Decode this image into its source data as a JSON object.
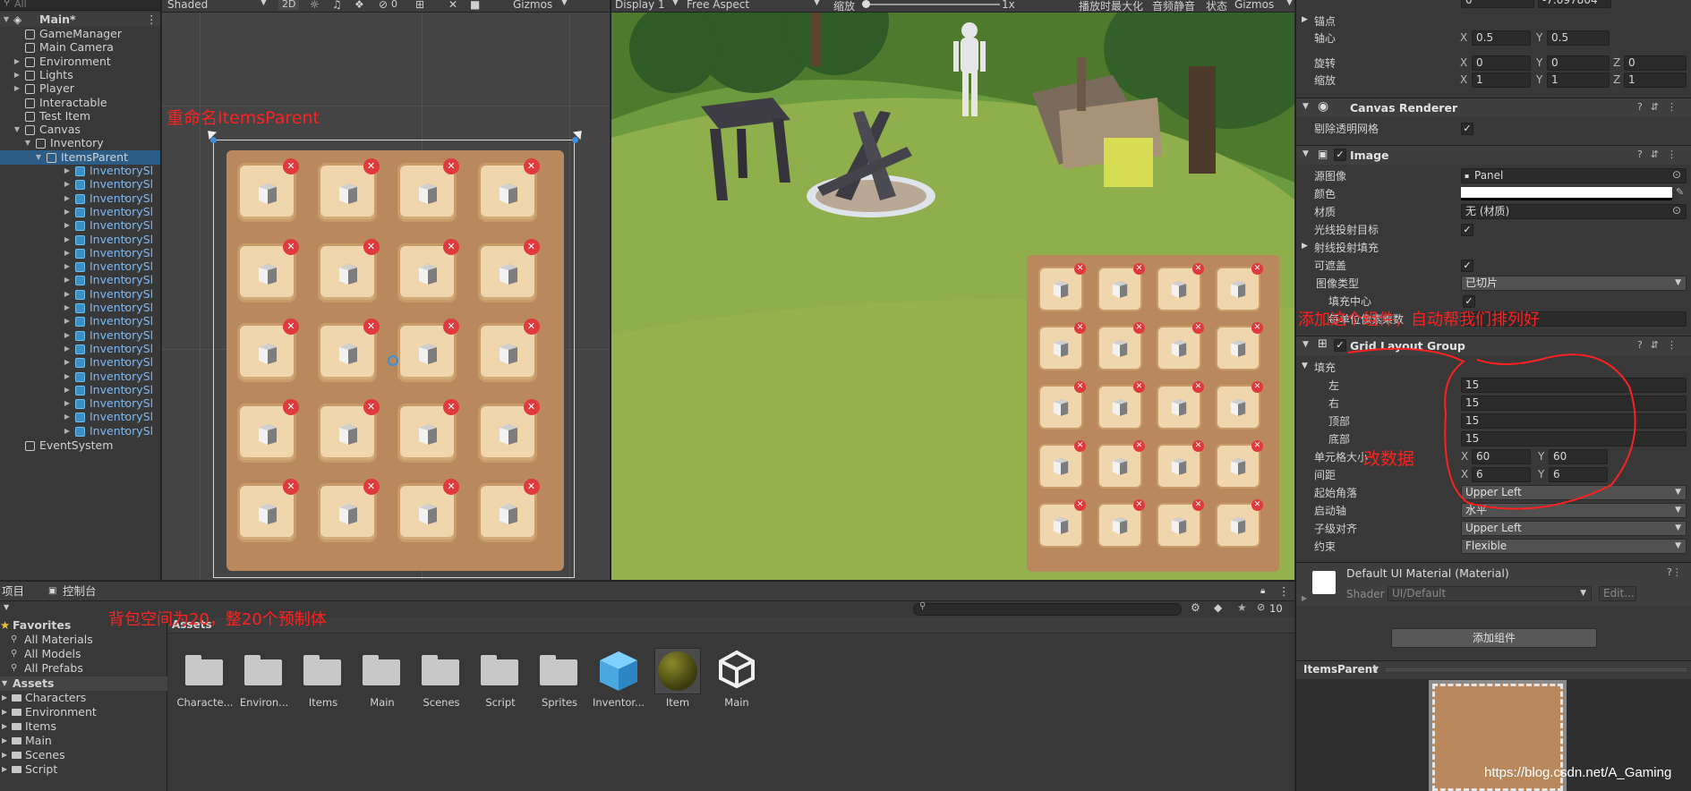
{
  "hierarchy": {
    "search_placeholder": "All",
    "scene": "Main*",
    "items": [
      {
        "label": "GameManager"
      },
      {
        "label": "Main Camera"
      },
      {
        "label": "Environment"
      },
      {
        "label": "Lights"
      },
      {
        "label": "Player"
      },
      {
        "label": "Interactable"
      },
      {
        "label": "Test Item"
      },
      {
        "label": "Canvas"
      },
      {
        "label": "Inventory"
      },
      {
        "label": "ItemsParent"
      },
      {
        "label": "InventorySl"
      },
      {
        "label": "EventSystem"
      }
    ],
    "slot_label": "InventorySl"
  },
  "scene_toolbar": {
    "shading": "Shaded",
    "mode2d": "2D",
    "hidden_count": "0",
    "gizmos": "Gizmos"
  },
  "game_toolbar": {
    "display": "Display 1",
    "aspect": "Free Aspect",
    "scale_label": "缩放",
    "scale_value": "1x",
    "maximize": "播放时最大化",
    "mute": "音频静音",
    "stats": "状态",
    "gizmos": "Gizmos"
  },
  "inspector": {
    "top_values": {
      "a": "0",
      "b": "-7.097804"
    },
    "anchors_label": "锚点",
    "pivot": {
      "label": "轴心",
      "x": "0.5",
      "y": "0.5"
    },
    "rotation": {
      "label": "旋转",
      "x": "0",
      "y": "0",
      "z": "0"
    },
    "scale": {
      "label": "缩放",
      "x": "1",
      "y": "1",
      "z": "1"
    },
    "canvas_renderer": {
      "title": "Canvas Renderer",
      "cull_label": "剔除透明网格"
    },
    "image": {
      "title": "Image",
      "source_label": "源图像",
      "source_value": "Panel",
      "color_label": "颜色",
      "material_label": "材质",
      "material_value": "无 (材质)",
      "raycast_target": "光线投射目标",
      "raycast_padding": "射线投射填充",
      "maskable": "可遮盖",
      "image_type_label": "图像类型",
      "image_type_value": "已切片",
      "fill_center": "填充中心",
      "ppu": "每单位像素乘数"
    },
    "grid": {
      "title": "Grid Layout Group",
      "padding": "填充",
      "left_label": "左",
      "left": "15",
      "right_label": "右",
      "right": "15",
      "top_label": "顶部",
      "top": "15",
      "bottom_label": "底部",
      "bottom": "15",
      "cell_label": "单元格大小",
      "cell_x": "60",
      "cell_y": "60",
      "spacing_label": "间距",
      "spacing_x": "6",
      "spacing_y": "6",
      "start_corner_label": "起始角落",
      "start_corner": "Upper Left",
      "start_axis_label": "启动轴",
      "start_axis": "水平",
      "child_align_label": "子级对齐",
      "child_align": "Upper Left",
      "constraint_label": "约束",
      "constraint": "Flexible"
    },
    "material": {
      "title": "Default UI Material (Material)",
      "shader_label": "Shader",
      "shader_value": "UI/Default",
      "edit": "Edit..."
    },
    "add_component": "添加组件",
    "preview_title": "ItemsParent"
  },
  "project": {
    "tab_project": "项目",
    "tab_console": "控制台",
    "favorites_title": "Favorites",
    "favorites": [
      "All Materials",
      "All Models",
      "All Prefabs"
    ],
    "assets_title": "Assets",
    "asset_tree": [
      "Characters",
      "Environment",
      "Items",
      "Main",
      "Scenes",
      "Script"
    ],
    "breadcrumb": "Assets",
    "hidden_count": "10",
    "assets": [
      {
        "label": "Characte...",
        "kind": "folder"
      },
      {
        "label": "Environ...",
        "kind": "folder"
      },
      {
        "label": "Items",
        "kind": "folder"
      },
      {
        "label": "Main",
        "kind": "folder"
      },
      {
        "label": "Scenes",
        "kind": "folder"
      },
      {
        "label": "Script",
        "kind": "folder"
      },
      {
        "label": "Sprites",
        "kind": "folder"
      },
      {
        "label": "Inventor...",
        "kind": "prefab"
      },
      {
        "label": "Item",
        "kind": "material"
      },
      {
        "label": "Main",
        "kind": "unity-scene"
      }
    ]
  },
  "annotations": {
    "rename": "重命名ItemsParent",
    "add_component": "添加这个组件，自动帮我们排列好",
    "change_data": "改数据",
    "bag_space": "背包空间为20，整20个预制体",
    "watermark": "https://blog.csdn.net/A_Gaming"
  },
  "colors": {
    "selection": "#2c5d87",
    "annotation": "#ff2020",
    "close_badge": "#e0393e",
    "panel": "#b9895d",
    "slot": "#f0d6ac"
  }
}
